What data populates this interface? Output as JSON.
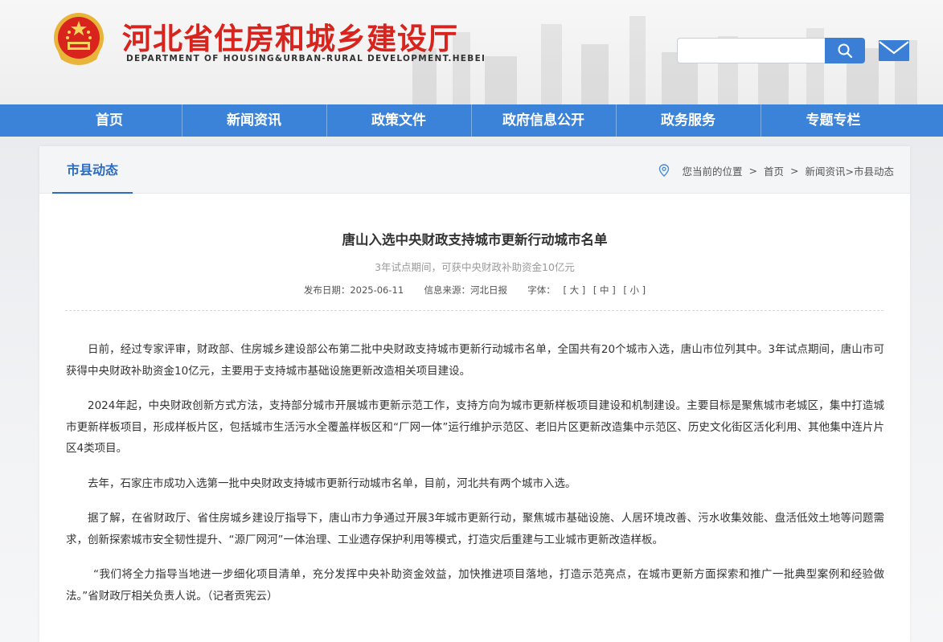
{
  "header": {
    "site_title": "河北省住房和城乡建设厅",
    "site_subtitle": "DEPARTMENT OF HOUSING&URBAN-RURAL DEVELOPMENT.HEBEI",
    "emblem_icon": "national-emblem-icon",
    "search": {
      "value": "",
      "placeholder": "",
      "button_icon": "search-icon"
    },
    "mail_icon": "mail-icon"
  },
  "nav": {
    "items": [
      {
        "label": "首页"
      },
      {
        "label": "新闻资讯"
      },
      {
        "label": "政策文件"
      },
      {
        "label": "政府信息公开"
      },
      {
        "label": "政务服务"
      },
      {
        "label": "专题专栏"
      }
    ]
  },
  "section": {
    "tab_label": "市县动态",
    "breadcrumb": {
      "icon": "location-pin-icon",
      "prefix": "您当前的位置",
      "home": "首页",
      "path": "新闻资讯>市县动态"
    }
  },
  "article": {
    "title": "唐山入选中央财政支持城市更新行动城市名单",
    "subtitle": "3年试点期间，可获中央财政补助资金10亿元",
    "meta": {
      "date_label": "发布日期：",
      "date": "2025-06-11",
      "source_label": "信息来源：",
      "source": "河北日报",
      "font_label": "字体：",
      "font_large": "[ 大 ]",
      "font_medium": "[ 中 ]",
      "font_small": "[ 小 ]"
    },
    "paragraphs": [
      "日前，经过专家评审，财政部、住房城乡建设部公布第二批中央财政支持城市更新行动城市名单，全国共有20个城市入选，唐山市位列其中。3年试点期间，唐山市可获得中央财政补助资金10亿元，主要用于支持城市基础设施更新改造相关项目建设。",
      "2024年起，中央财政创新方式方法，支持部分城市开展城市更新示范工作，支持方向为城市更新样板项目建设和机制建设。主要目标是聚焦城市老城区，集中打造城市更新样板项目，形成样板片区，包括城市生活污水全覆盖样板区和“厂网一体”运行维护示范区、老旧片区更新改造集中示范区、历史文化街区活化利用、其他集中连片片区4类项目。",
      "去年，石家庄市成功入选第一批中央财政支持城市更新行动城市名单，目前，河北共有两个城市入选。",
      "据了解，在省财政厅、省住房城乡建设厅指导下，唐山市力争通过开展3年城市更新行动，聚焦城市基础设施、人居环境改善、污水收集效能、盘活低效土地等问题需求，创新探索城市安全韧性提升、“源厂网河”一体治理、工业遗存保护利用等模式，打造灾后重建与工业城市更新改造样板。",
      "“我们将全力指导当地进一步细化项目清单，充分发挥中央补助资金效益，加快推进项目落地，打造示范亮点，在城市更新方面探索和推广一批典型案例和经验做法。”省财政厅相关负责人说。（记者贡宪云）"
    ]
  },
  "colors": {
    "title_red": "#d8241c",
    "nav_blue": "#3b82d9",
    "accent_blue": "#2b6cc4"
  }
}
